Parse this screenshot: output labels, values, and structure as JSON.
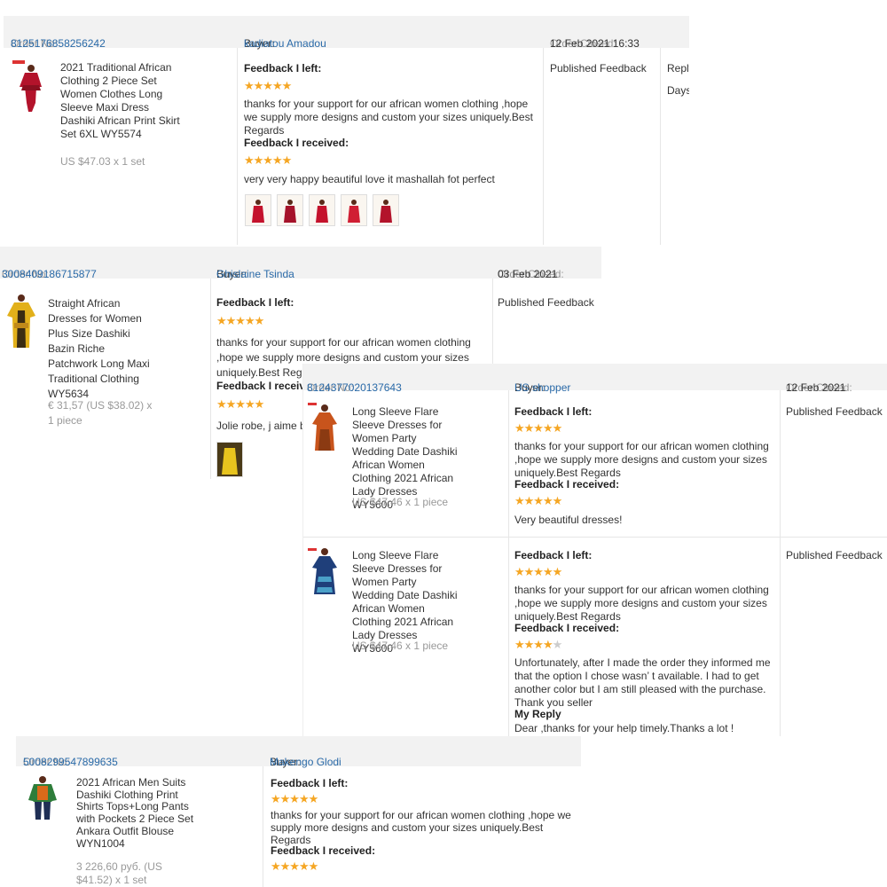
{
  "orders": [
    {
      "order_no_label": "Order No:",
      "order_no": "8125176858256242",
      "buyer_label": "Buyer:",
      "buyer": "kadiatou Amadou",
      "closed_label": "Order Closed:",
      "closed": "12 Feb 2021 16:33",
      "product_title": "2021 Traditional African Clothing 2 Piece Set Women Clothes Long Sleeve Maxi Dress Dashiki African Print Skirt Set 6XL WY5574",
      "price": "US $47.03 x 1 set",
      "left_label": "Feedback I left:",
      "left_stars": 5,
      "left_text": "thanks for your support for our african women clothing ,hope we supply more designs and custom your sizes uniquely.Best Regards",
      "received_label": "Feedback I received:",
      "received_stars": 5,
      "received_text": "very very happy beautiful love it mashallah fot perfect",
      "status": "Published Feedback",
      "action": "Reply",
      "action_sub": "Days"
    },
    {
      "order_no_label": "Order No:",
      "order_no": "3008409186715877",
      "buyer_label": "Buyer:",
      "buyer": "Ghislaine Tsinda",
      "closed_label": "Order Closed:",
      "closed": "03 Feb 2021",
      "product_title": "Straight African Dresses for Women Plus Size Dashiki Bazin Riche Patchwork Long Maxi Traditional Clothing WY5634",
      "price": "€ 31,57 (US $38.02) x 1 piece",
      "left_label": "Feedback I left:",
      "left_stars": 5,
      "left_text": "thanks for your support for our african women clothing ,hope we supply more designs and custom your sizes uniquely.Best Regards",
      "received_label": "Feedback I received:",
      "received_stars": 5,
      "received_text": "Jolie robe, j aime bien",
      "status": "Published Feedback"
    },
    {
      "order_no_label": "Order No:",
      "order_no": "8124377020137643",
      "buyer_label": "Buyer:",
      "buyer": "US shopper",
      "closed_label": "Order Closed:",
      "closed": "12 Feb 2021",
      "items": [
        {
          "product_title": "Long Sleeve Flare Sleeve Dresses for Women Party Wedding Date Dashiki African Women Clothing 2021 African Lady Dresses WY5600",
          "price": "US $47.46 x 1 piece",
          "left_label": "Feedback I left:",
          "left_stars": 5,
          "left_text": "thanks for your support for our african women clothing ,hope we supply more designs and custom your sizes uniquely.Best Regards",
          "received_label": "Feedback I received:",
          "received_stars": 5,
          "received_text": "Very beautiful dresses!",
          "status": "Published Feedback"
        },
        {
          "product_title": "Long Sleeve Flare Sleeve Dresses for Women Party Wedding Date Dashiki African Women Clothing 2021 African Lady Dresses WY5600",
          "price": "US $47.46 x 1 piece",
          "left_label": "Feedback I left:",
          "left_stars": 5,
          "left_text": "thanks for your support for our african women clothing ,hope we supply more designs and custom your sizes uniquely.Best Regards",
          "received_label": "Feedback I received:",
          "received_stars": 4,
          "received_text": "Unfortunately, after I made the order they informed me that the option I chose wasn’ t available. I had to get another color but I am still pleased with the purchase. Thank you seller",
          "reply_label": "My Reply",
          "reply_text": "Dear ,thanks for your help timely.Thanks a lot !",
          "status": "Published Feedback"
        }
      ]
    },
    {
      "order_no_label": "Order No:",
      "order_no": "5008299547899635",
      "buyer_label": "Buyer:",
      "buyer": "Makengo Glodi",
      "product_title": "2021 African Men Suits Dashiki Clothing Print Shirts Tops+Long Pants with Pockets 2 Piece Set Ankara Outfit Blouse WYN1004",
      "price": "3 226,60 руб. (US $41.52) x 1 set",
      "left_label": "Feedback I left:",
      "left_stars": 5,
      "left_text": "thanks for your support for our african women clothing ,hope we supply more designs and custom your sizes uniquely.Best Regards",
      "received_label": "Feedback I received:",
      "received_stars": 5
    }
  ],
  "colors": {
    "link": "#2a6aa8",
    "star": "#f5a623",
    "header_bg": "#f2f2f2"
  }
}
